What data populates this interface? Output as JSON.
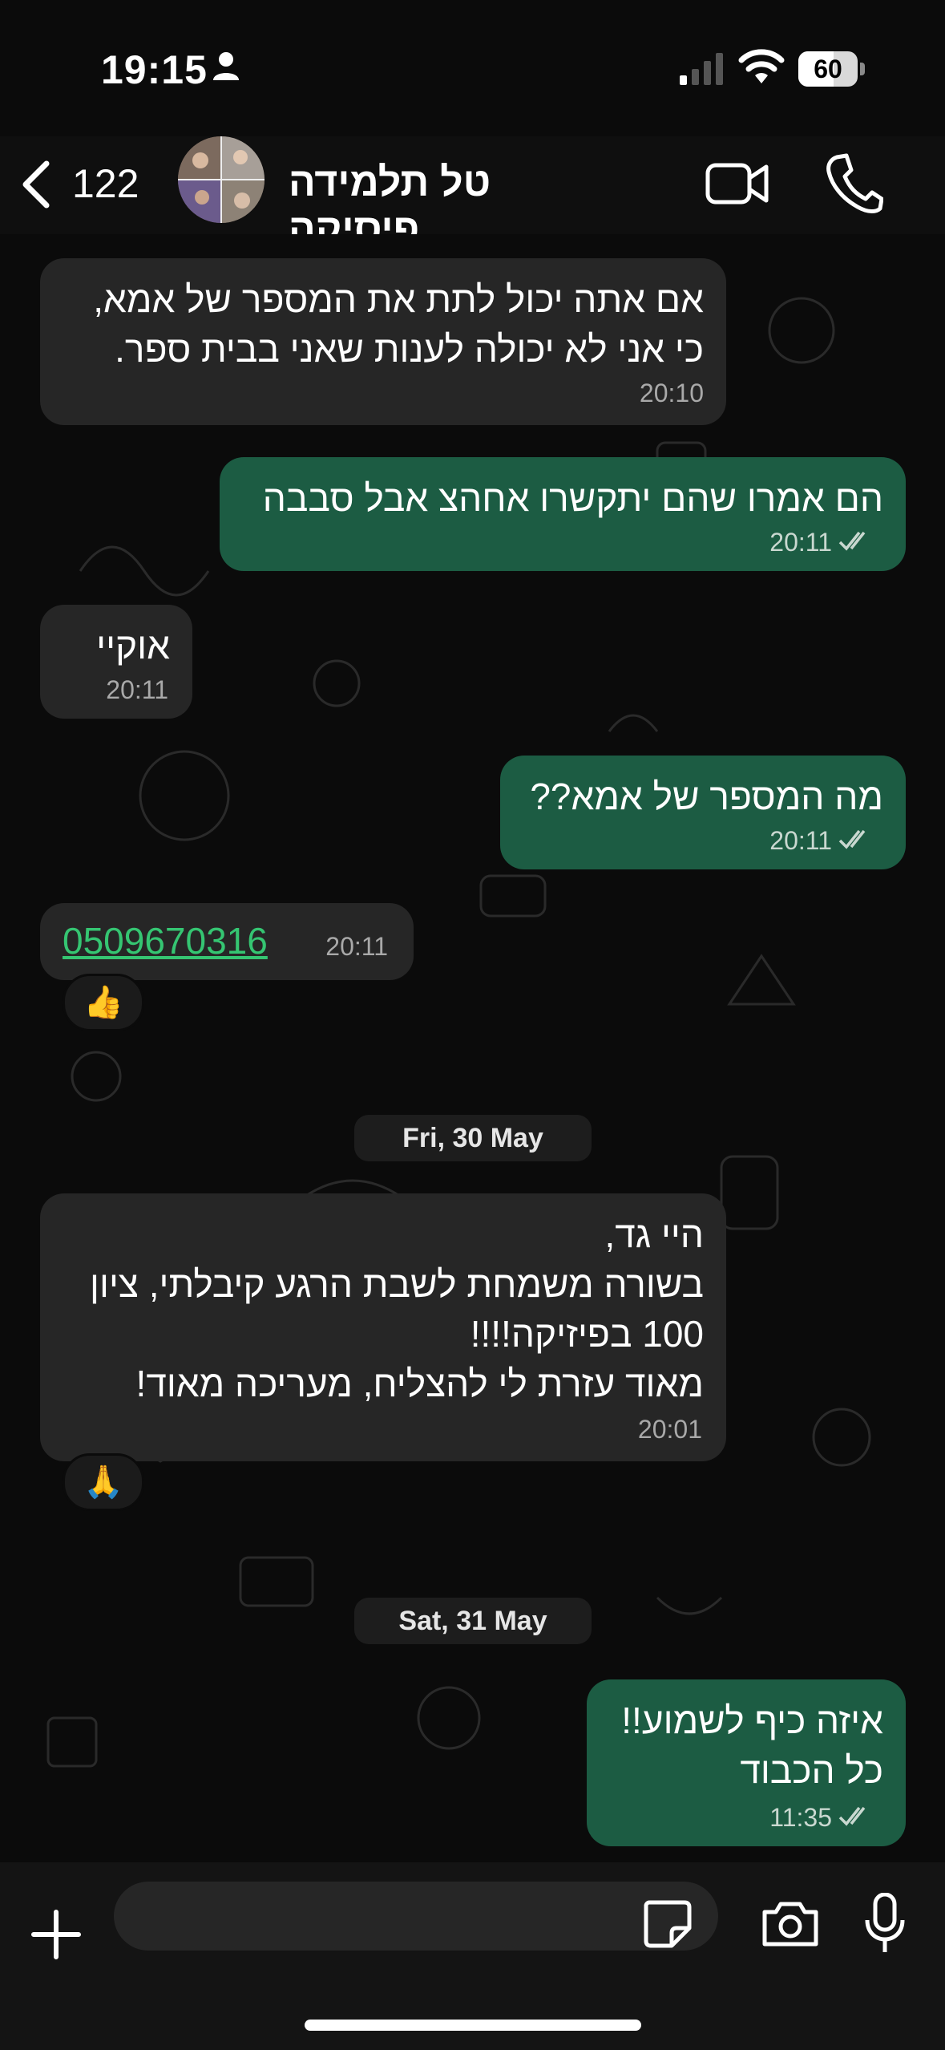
{
  "status_bar": {
    "time": "19:15",
    "battery": "60",
    "battery_level_pct": 60
  },
  "header": {
    "back_count": "122",
    "contact_name": "טל תלמידה פיסיקה"
  },
  "messages": [
    {
      "dir": "in",
      "lines": [
        "אם אתה יכול לתת את המספר של אמא,",
        "כי אני לא יכולה לענות שאני בבית ספר."
      ],
      "time": "20:10"
    },
    {
      "dir": "out",
      "lines": [
        "הם אמרו שהם יתקשרו אחהצ אבל סבבה"
      ],
      "time": "20:11"
    },
    {
      "dir": "in",
      "lines": [
        "אוקיי"
      ],
      "time": "20:11"
    },
    {
      "dir": "out",
      "lines": [
        "מה המספר של אמא??"
      ],
      "time": "20:11"
    },
    {
      "dir": "in",
      "link": "0509670316",
      "time": "20:11",
      "reaction": "👍"
    },
    {
      "dir": "in",
      "lines": [
        "היי גד,",
        "בשורה משמחת לשבת הרגע קיבלתי, ציון",
        "100 בפיזיקה!!!!",
        "מאוד עזרת לי להצליח, מעריכה מאוד!"
      ],
      "time": "20:01",
      "reaction": "🙏"
    },
    {
      "dir": "out",
      "lines": [
        "איזה כיף לשמוע!!",
        "כל הכבוד"
      ],
      "time": "11:35"
    }
  ],
  "dates": [
    "Fri, 30 May",
    "Sat, 31 May"
  ],
  "icons": {
    "back": "chevron-left-icon",
    "video": "video-camera-icon",
    "phone": "phone-icon",
    "plus": "plus-icon",
    "sticker": "sticker-icon",
    "camera": "camera-icon",
    "mic": "microphone-icon"
  },
  "colors": {
    "outgoing_bubble": "#1c5c43",
    "incoming_bubble": "#262626",
    "link": "#35c572"
  }
}
